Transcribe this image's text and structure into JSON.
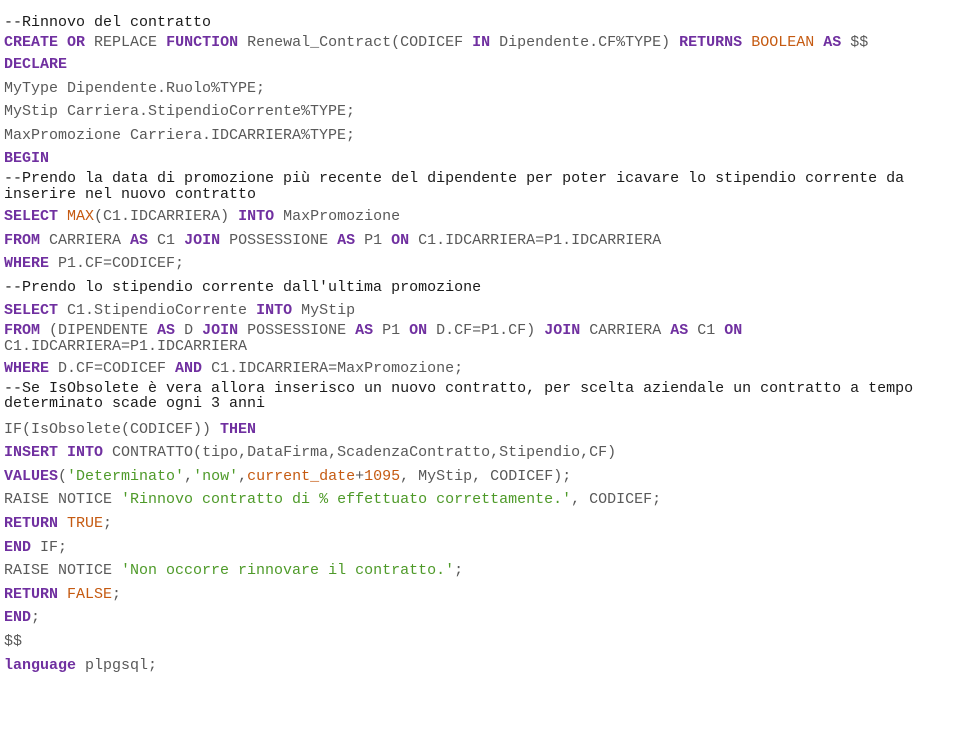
{
  "colors": {
    "comment": "#1a1a1a",
    "keyword": "#7030a0",
    "plain": "#595959",
    "func": "#c55a11",
    "string": "#4e9a29"
  },
  "lines": [
    {
      "style": "normal",
      "tokens": [
        {
          "t": "comment",
          "v": "--Rinnovo del contratto"
        }
      ]
    },
    {
      "style": "tight",
      "tokens": [
        {
          "t": "keyword",
          "v": "CREATE"
        },
        {
          "t": "plain",
          "v": " "
        },
        {
          "t": "keyword",
          "v": "OR"
        },
        {
          "t": "plain",
          "v": " REPLACE "
        },
        {
          "t": "keyword",
          "v": "FUNCTION"
        },
        {
          "t": "plain",
          "v": " Renewal_Contract(CODICEF "
        },
        {
          "t": "keyword",
          "v": "IN"
        },
        {
          "t": "plain",
          "v": " Dipendente.CF%TYPE) "
        },
        {
          "t": "keyword",
          "v": "RETURNS"
        },
        {
          "t": "plain",
          "v": " "
        },
        {
          "t": "func",
          "v": "BOOLEAN"
        },
        {
          "t": "plain",
          "v": " "
        },
        {
          "t": "keyword",
          "v": "AS"
        },
        {
          "t": "plain",
          "v": " $$"
        }
      ]
    },
    {
      "style": "normal",
      "tokens": [
        {
          "t": "keyword",
          "v": "DECLARE"
        }
      ]
    },
    {
      "style": "normal",
      "tokens": [
        {
          "t": "plain",
          "v": "MyType Dipendente.Ruolo%TYPE;"
        }
      ]
    },
    {
      "style": "normal",
      "tokens": [
        {
          "t": "plain",
          "v": "MyStip Carriera.StipendioCorrente%TYPE;"
        }
      ]
    },
    {
      "style": "normal",
      "tokens": [
        {
          "t": "plain",
          "v": "MaxPromozione Carriera.IDCARRIERA%TYPE;"
        }
      ]
    },
    {
      "style": "normal",
      "tokens": [
        {
          "t": "keyword",
          "v": "BEGIN"
        }
      ]
    },
    {
      "style": "tight",
      "tokens": [
        {
          "t": "comment",
          "v": "--Prendo la data di promozione più recente del dipendente per poter icavare lo stipendio corrente da inserire nel nuovo contratto"
        }
      ]
    },
    {
      "style": "normal",
      "tokens": [
        {
          "t": "keyword",
          "v": "SELECT"
        },
        {
          "t": "plain",
          "v": " "
        },
        {
          "t": "func",
          "v": "MAX"
        },
        {
          "t": "plain",
          "v": "(C1.IDCARRIERA) "
        },
        {
          "t": "keyword",
          "v": "INTO"
        },
        {
          "t": "plain",
          "v": " MaxPromozione"
        }
      ]
    },
    {
      "style": "normal",
      "tokens": [
        {
          "t": "keyword",
          "v": "FROM"
        },
        {
          "t": "plain",
          "v": " CARRIERA "
        },
        {
          "t": "keyword",
          "v": "AS"
        },
        {
          "t": "plain",
          "v": " C1 "
        },
        {
          "t": "keyword",
          "v": "JOIN"
        },
        {
          "t": "plain",
          "v": " POSSESSIONE "
        },
        {
          "t": "keyword",
          "v": "AS"
        },
        {
          "t": "plain",
          "v": " P1 "
        },
        {
          "t": "keyword",
          "v": "ON"
        },
        {
          "t": "plain",
          "v": " C1.IDCARRIERA=P1.IDCARRIERA"
        }
      ]
    },
    {
      "style": "normal",
      "tokens": [
        {
          "t": "keyword",
          "v": "WHERE"
        },
        {
          "t": "plain",
          "v": " P1.CF=CODICEF;"
        }
      ]
    },
    {
      "style": "normal",
      "tokens": [
        {
          "t": "comment",
          "v": "--Prendo lo stipendio corrente dall'ultima promozione"
        }
      ]
    },
    {
      "style": "normal",
      "tokens": [
        {
          "t": "keyword",
          "v": "SELECT"
        },
        {
          "t": "plain",
          "v": " C1.StipendioCorrente "
        },
        {
          "t": "keyword",
          "v": "INTO"
        },
        {
          "t": "plain",
          "v": " MyStip"
        }
      ]
    },
    {
      "style": "tight",
      "tokens": [
        {
          "t": "keyword",
          "v": "FROM"
        },
        {
          "t": "plain",
          "v": " (DIPENDENTE "
        },
        {
          "t": "keyword",
          "v": "AS"
        },
        {
          "t": "plain",
          "v": " D "
        },
        {
          "t": "keyword",
          "v": "JOIN"
        },
        {
          "t": "plain",
          "v": " POSSESSIONE "
        },
        {
          "t": "keyword",
          "v": "AS"
        },
        {
          "t": "plain",
          "v": " P1 "
        },
        {
          "t": "keyword",
          "v": "ON"
        },
        {
          "t": "plain",
          "v": " D.CF=P1.CF) "
        },
        {
          "t": "keyword",
          "v": "JOIN"
        },
        {
          "t": "plain",
          "v": " CARRIERA "
        },
        {
          "t": "keyword",
          "v": "AS"
        },
        {
          "t": "plain",
          "v": " C1 "
        },
        {
          "t": "keyword",
          "v": "ON"
        },
        {
          "t": "plain",
          "v": " C1.IDCARRIERA=P1.IDCARRIERA"
        }
      ]
    },
    {
      "style": "normal",
      "tokens": [
        {
          "t": "keyword",
          "v": "WHERE"
        },
        {
          "t": "plain",
          "v": " D.CF=CODICEF "
        },
        {
          "t": "keyword",
          "v": "AND"
        },
        {
          "t": "plain",
          "v": " C1.IDCARRIERA=MaxPromozione;"
        }
      ]
    },
    {
      "style": "tight-last",
      "tokens": [
        {
          "t": "comment",
          "v": "--Se IsObsolete è vera allora inserisco un nuovo contratto, per scelta aziendale un contratto a tempo determinato scade ogni 3 anni"
        }
      ]
    },
    {
      "style": "normal",
      "tokens": [
        {
          "t": "plain",
          "v": "IF(IsObsolete(CODICEF)) "
        },
        {
          "t": "keyword",
          "v": "THEN"
        }
      ]
    },
    {
      "style": "normal",
      "tokens": [
        {
          "t": "keyword",
          "v": "INSERT"
        },
        {
          "t": "plain",
          "v": " "
        },
        {
          "t": "keyword",
          "v": "INTO"
        },
        {
          "t": "plain",
          "v": " CONTRATTO(tipo,DataFirma,ScadenzaContratto,Stipendio,CF)"
        }
      ]
    },
    {
      "style": "normal",
      "tokens": [
        {
          "t": "keyword",
          "v": "VALUES"
        },
        {
          "t": "plain",
          "v": "("
        },
        {
          "t": "string",
          "v": "'Determinato'"
        },
        {
          "t": "plain",
          "v": ","
        },
        {
          "t": "string",
          "v": "'now'"
        },
        {
          "t": "plain",
          "v": ","
        },
        {
          "t": "func",
          "v": "current_date"
        },
        {
          "t": "plain",
          "v": "+"
        },
        {
          "t": "func",
          "v": "1095"
        },
        {
          "t": "plain",
          "v": ", MyStip, CODICEF);"
        }
      ]
    },
    {
      "style": "normal",
      "tokens": [
        {
          "t": "plain",
          "v": "RAISE NOTICE "
        },
        {
          "t": "string",
          "v": "'Rinnovo contratto di % effettuato correttamente.'"
        },
        {
          "t": "plain",
          "v": ", CODICEF;"
        }
      ]
    },
    {
      "style": "normal",
      "tokens": [
        {
          "t": "keyword",
          "v": "RETURN"
        },
        {
          "t": "plain",
          "v": " "
        },
        {
          "t": "func",
          "v": "TRUE"
        },
        {
          "t": "plain",
          "v": ";"
        }
      ]
    },
    {
      "style": "normal",
      "tokens": [
        {
          "t": "keyword",
          "v": "END"
        },
        {
          "t": "plain",
          "v": " IF;"
        }
      ]
    },
    {
      "style": "normal",
      "tokens": [
        {
          "t": "plain",
          "v": "RAISE NOTICE "
        },
        {
          "t": "string",
          "v": "'Non occorre rinnovare il contratto.'"
        },
        {
          "t": "plain",
          "v": ";"
        }
      ]
    },
    {
      "style": "normal",
      "tokens": [
        {
          "t": "keyword",
          "v": "RETURN"
        },
        {
          "t": "plain",
          "v": " "
        },
        {
          "t": "func",
          "v": "FALSE"
        },
        {
          "t": "plain",
          "v": ";"
        }
      ]
    },
    {
      "style": "normal",
      "tokens": [
        {
          "t": "keyword",
          "v": "END"
        },
        {
          "t": "plain",
          "v": ";"
        }
      ]
    },
    {
      "style": "normal",
      "tokens": [
        {
          "t": "plain",
          "v": "$$"
        }
      ]
    },
    {
      "style": "normal",
      "tokens": [
        {
          "t": "keyword",
          "v": "language"
        },
        {
          "t": "plain",
          "v": " plpgsql;"
        }
      ]
    }
  ]
}
